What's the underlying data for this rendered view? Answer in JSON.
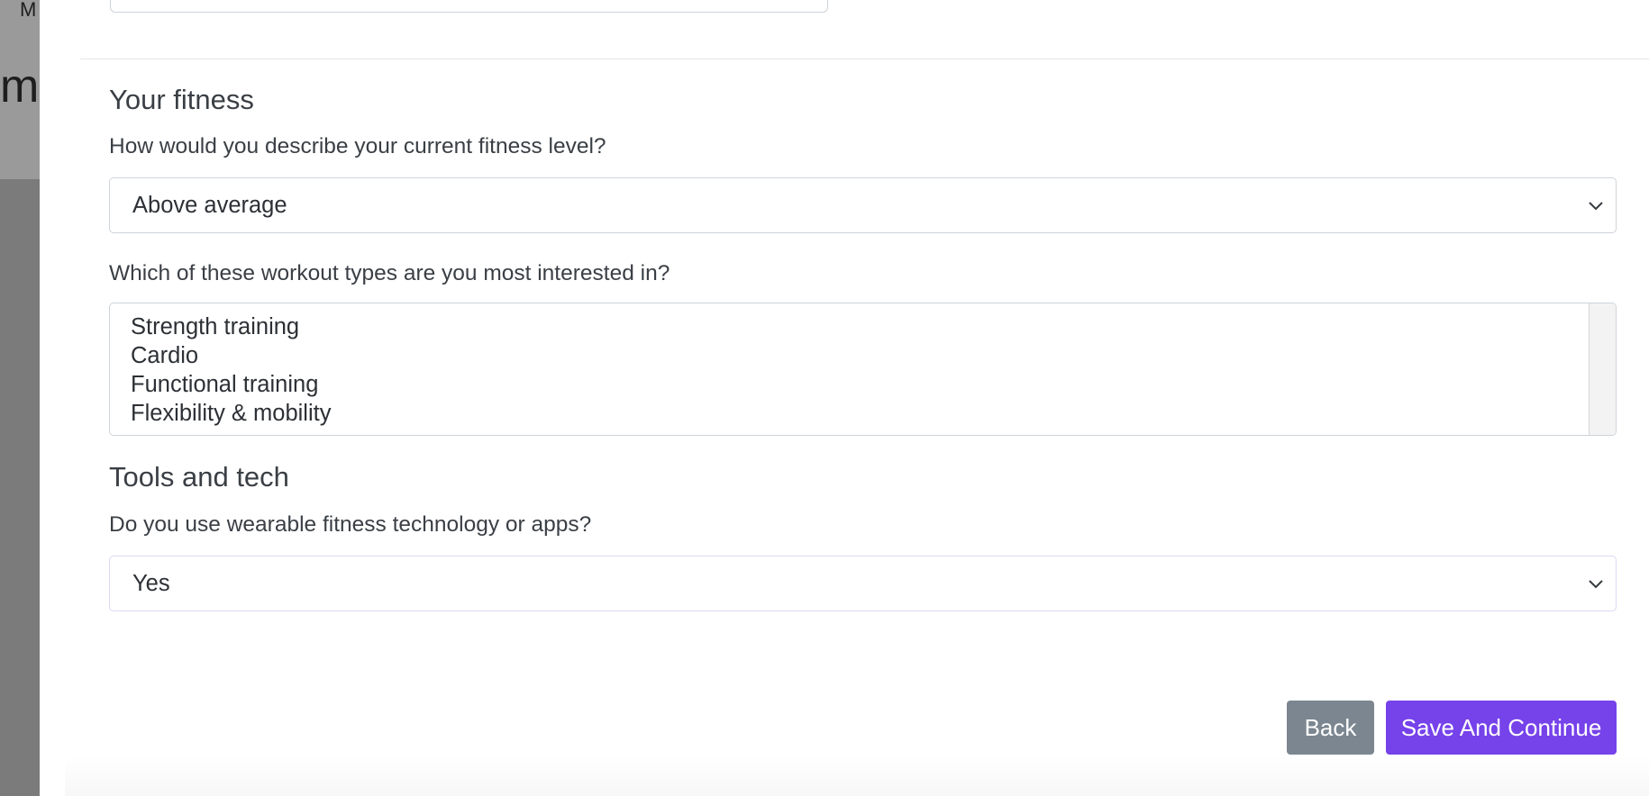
{
  "backdrop": {
    "letter_top": "M",
    "letter_big": "m"
  },
  "sections": {
    "fitness": {
      "title": "Your fitness",
      "level_question": "How would you describe your current fitness level?",
      "level_value": "Above average",
      "workout_question": "Which of these workout types are you most interested in?",
      "workout_options": [
        "Strength training",
        "Cardio",
        "Functional training",
        "Flexibility & mobility"
      ]
    },
    "tools": {
      "title": "Tools and tech",
      "wearable_question": "Do you use wearable fitness technology or apps?",
      "wearable_value": "Yes"
    }
  },
  "actions": {
    "back_label": "Back",
    "save_label": "Save And Continue"
  },
  "colors": {
    "primary": "#7642ea",
    "secondary": "#7b8690",
    "text": "#3a3f45",
    "border": "#ced4da"
  },
  "icons": {
    "select_chevron": "chevron-down-icon"
  }
}
